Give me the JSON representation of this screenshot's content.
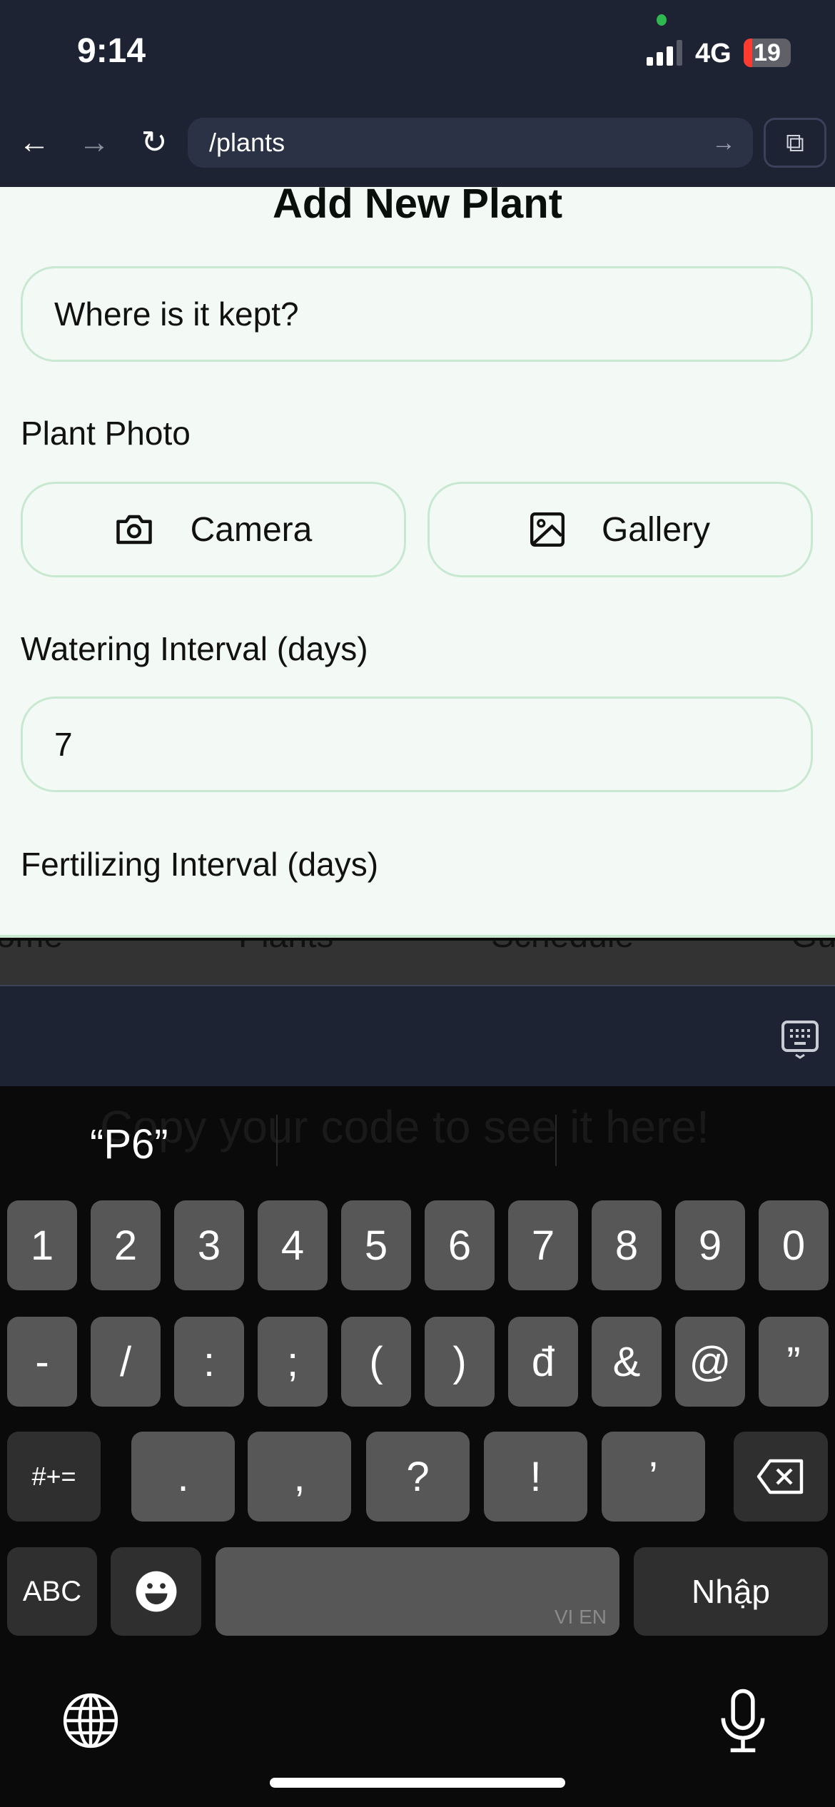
{
  "status": {
    "time": "9:14",
    "network": "4G",
    "battery": "19"
  },
  "browser": {
    "url": "/plants",
    "back_icon": "←",
    "forward_icon": "→",
    "reload_icon": "↻",
    "go_icon": "→",
    "external_icon": "⧉"
  },
  "form": {
    "title": "Add New Plant",
    "location_placeholder": "Where is it kept?",
    "photo_label": "Plant Photo",
    "camera_label": "Camera",
    "gallery_label": "Gallery",
    "watering_label": "Watering Interval (days)",
    "watering_value": "7",
    "fertilizing_label": "Fertilizing Interval (days)"
  },
  "tabs": [
    "Home",
    "Plants",
    "Schedule",
    "Gui"
  ],
  "keyboard": {
    "ghost_text": "Copy your code to see it here!",
    "suggestion": "“P6”",
    "row1": [
      "1",
      "2",
      "3",
      "4",
      "5",
      "6",
      "7",
      "8",
      "9",
      "0"
    ],
    "row2": [
      "-",
      "/",
      ":",
      ";",
      "(",
      ")",
      "đ",
      "&",
      "@",
      "”"
    ],
    "symbols_key": "#+=",
    "row3": [
      ".",
      ",",
      "?",
      "!",
      "’"
    ],
    "abc_key": "ABC",
    "space_langs": "VI EN",
    "return_key": "Nhập"
  }
}
